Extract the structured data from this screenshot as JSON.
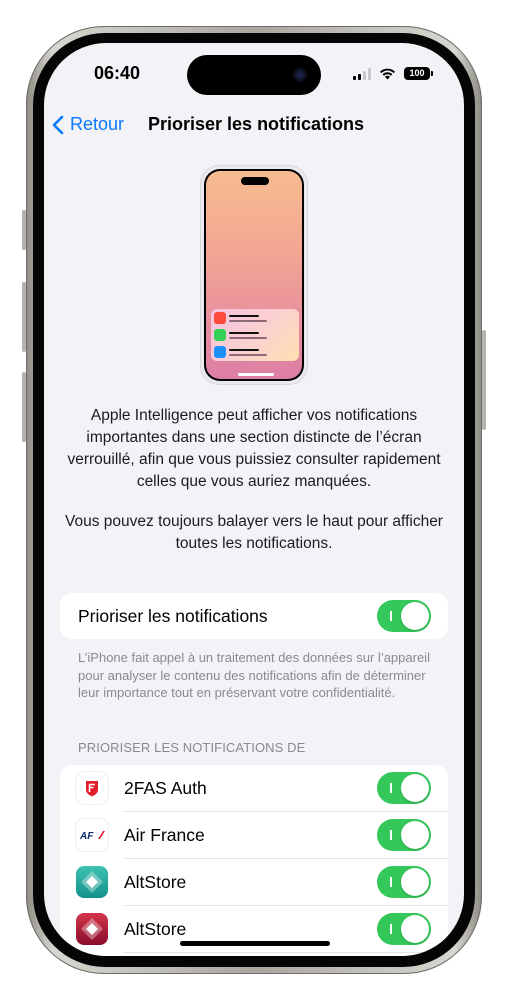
{
  "status_bar": {
    "time": "06:40",
    "battery": "100",
    "signal_bars_active": 2,
    "signal_bars_total": 4
  },
  "nav": {
    "back_label": "Retour",
    "title": "Prioriser les notifications"
  },
  "illustration": {
    "notification_app_colors": [
      "#ff4b3e",
      "#34d058",
      "#1e90ff"
    ]
  },
  "description": {
    "paragraph_1": "Apple Intelligence peut afficher vos notifications importantes dans une section distincte de l’écran verrouillé, afin que vous puissiez consulter rapidement celles que vous auriez manquées.",
    "paragraph_2": "Vous pouvez toujours balayer vers le haut pour afficher toutes les notifications."
  },
  "main_toggle": {
    "label": "Prioriser les notifications",
    "on": true
  },
  "footnote": "L’iPhone fait appel à un traitement des données sur l’appareil pour analyser le contenu des notifications afin de déterminer leur importance tout en préservant votre confidentialité.",
  "apps_section": {
    "header": "PRIORISER LES NOTIFICATIONS DE",
    "apps": [
      {
        "name": "2FAS Auth",
        "icon": "2fas-shield-icon",
        "on": true
      },
      {
        "name": "Air France",
        "icon": "air-france-logo-icon",
        "on": true
      },
      {
        "name": "AltStore",
        "icon": "altstore-teal-icon",
        "on": true
      },
      {
        "name": "AltStore",
        "icon": "altstore-red-icon",
        "on": true
      }
    ]
  },
  "colors": {
    "accent": "#0a7aff",
    "toggle_on": "#34c759",
    "background": "#f2f2f7"
  }
}
